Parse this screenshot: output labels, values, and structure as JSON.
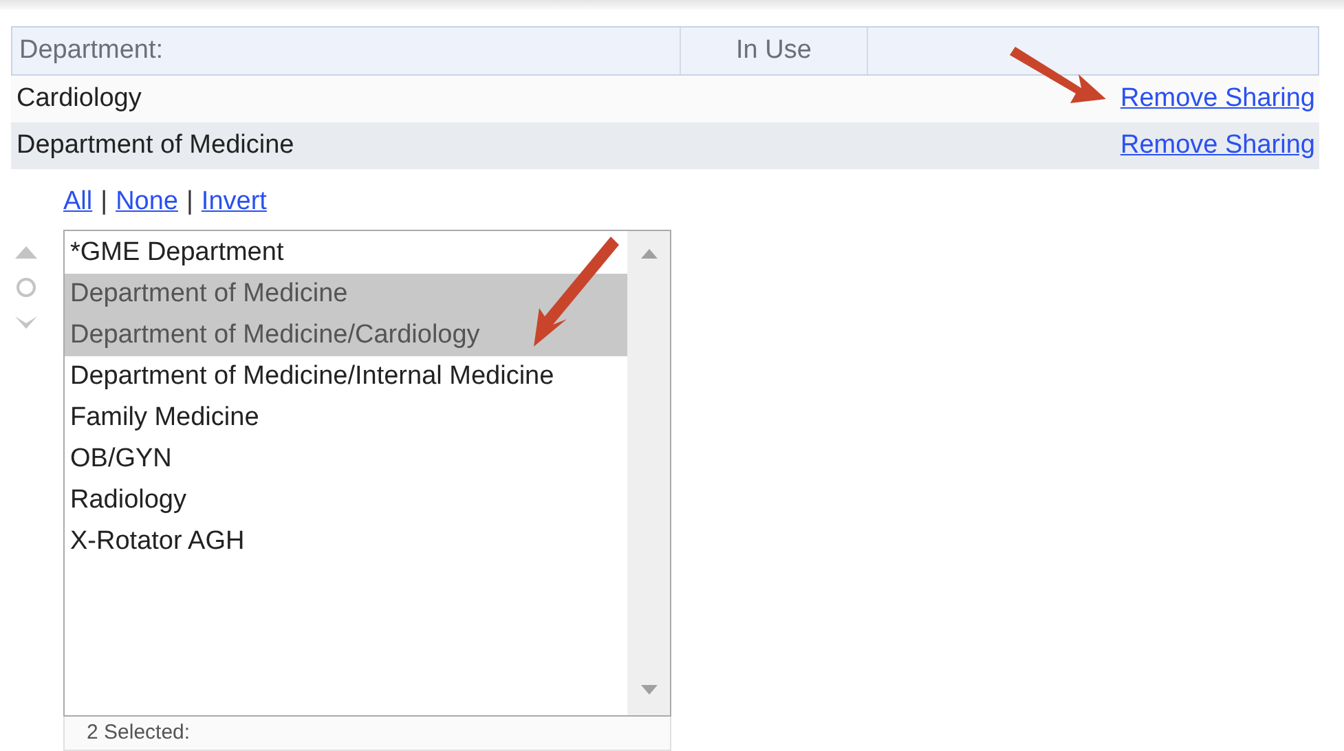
{
  "table": {
    "columns": [
      "Department:",
      "In Use"
    ],
    "rows": [
      {
        "department": "Cardiology",
        "action": "Remove Sharing"
      },
      {
        "department": "Department of Medicine",
        "action": "Remove Sharing"
      }
    ]
  },
  "selection_links": {
    "items": [
      "All",
      "None",
      "Invert"
    ],
    "separator": "|"
  },
  "list": {
    "items": [
      {
        "label": "*GME Department",
        "selected": false
      },
      {
        "label": "Department of Medicine",
        "selected": true
      },
      {
        "label": "Department of Medicine/Cardiology",
        "selected": true
      },
      {
        "label": "Department of Medicine/Internal Medicine",
        "selected": false
      },
      {
        "label": "Family Medicine",
        "selected": false
      },
      {
        "label": "OB/GYN",
        "selected": false
      },
      {
        "label": "Radiology",
        "selected": false
      },
      {
        "label": "X-Rotator AGH",
        "selected": false
      }
    ],
    "footer": "2 Selected:"
  }
}
